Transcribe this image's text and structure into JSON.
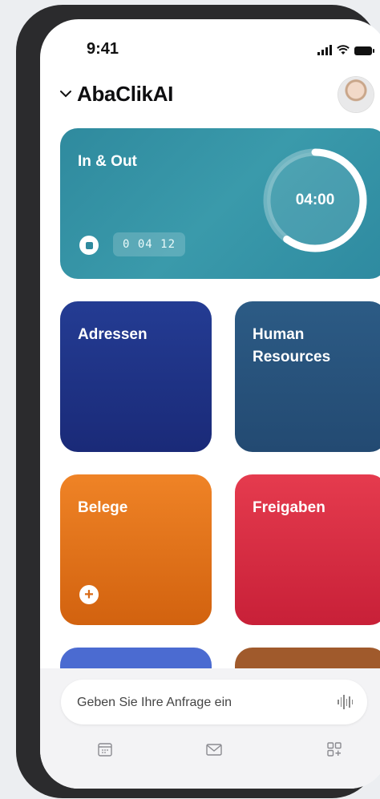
{
  "status": {
    "time": "9:41"
  },
  "header": {
    "title": "AbaClikAI",
    "chevron": "chevron-down-icon",
    "avatar": "user-avatar"
  },
  "inout": {
    "label": "In & Out",
    "timer": "04:00",
    "timer_progress": 0.6,
    "counter": "0 04 12",
    "stop_icon": "stop-icon"
  },
  "tiles": {
    "adressen": {
      "label": "Adressen",
      "color": "#1f3487"
    },
    "hr": {
      "label": "Human\nResources",
      "color": "#275380"
    },
    "belege": {
      "label": "Belege",
      "color": "#e5751c",
      "add_icon": "plus-icon"
    },
    "freigaben": {
      "label": "Freigaben",
      "color": "#d82d43"
    }
  },
  "query": {
    "placeholder": "Geben Sie Ihre Anfrage ein",
    "voice_icon": "waveform-icon"
  },
  "tabbar": {
    "items": [
      "calendar-icon",
      "mail-icon",
      "apps-add-icon"
    ]
  }
}
